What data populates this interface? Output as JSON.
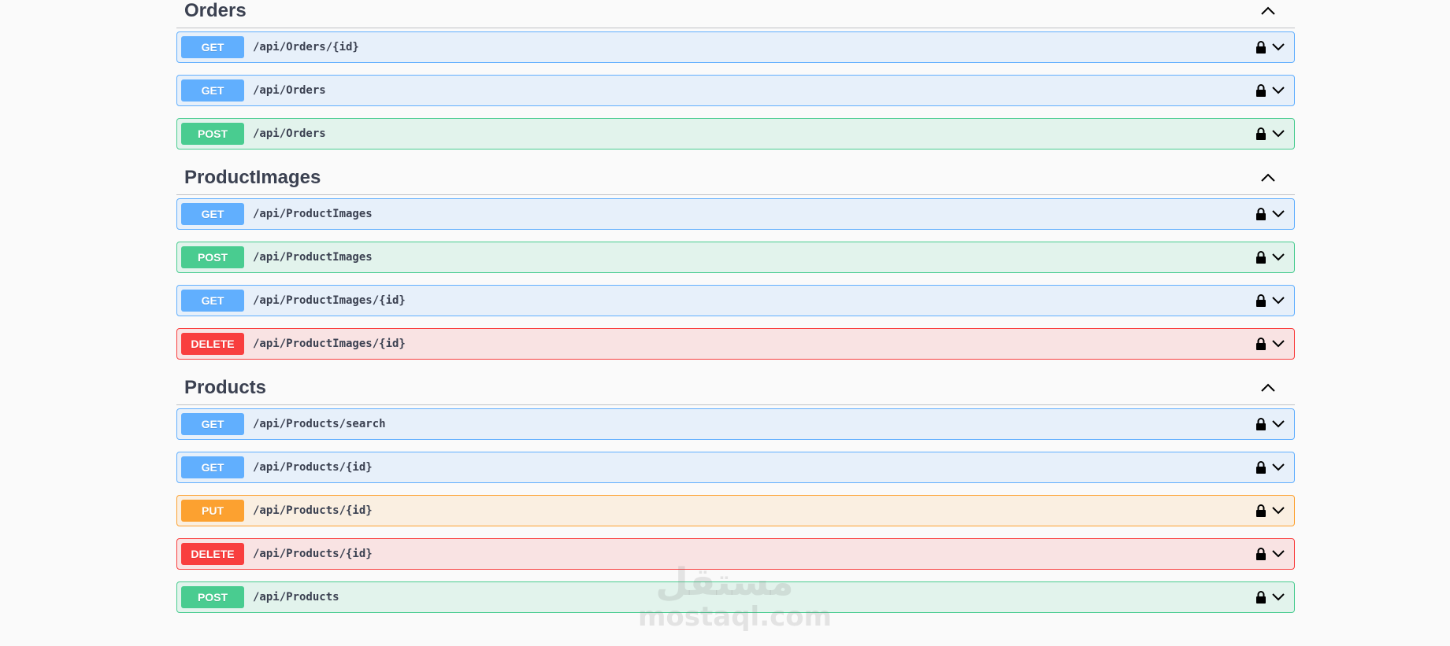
{
  "sections": [
    {
      "name": "Orders",
      "operations": [
        {
          "method": "GET",
          "path": "/api/Orders/{id}"
        },
        {
          "method": "GET",
          "path": "/api/Orders"
        },
        {
          "method": "POST",
          "path": "/api/Orders"
        }
      ]
    },
    {
      "name": "ProductImages",
      "operations": [
        {
          "method": "GET",
          "path": "/api/ProductImages"
        },
        {
          "method": "POST",
          "path": "/api/ProductImages"
        },
        {
          "method": "GET",
          "path": "/api/ProductImages/{id}"
        },
        {
          "method": "DELETE",
          "path": "/api/ProductImages/{id}"
        }
      ]
    },
    {
      "name": "Products",
      "operations": [
        {
          "method": "GET",
          "path": "/api/Products/search"
        },
        {
          "method": "GET",
          "path": "/api/Products/{id}"
        },
        {
          "method": "PUT",
          "path": "/api/Products/{id}"
        },
        {
          "method": "DELETE",
          "path": "/api/Products/{id}"
        },
        {
          "method": "POST",
          "path": "/api/Products"
        }
      ]
    }
  ],
  "watermark": {
    "arabic": "مستقل",
    "latin": "mostaql.com"
  },
  "icons": {
    "section_toggle": "chevron-up-icon",
    "lock": "lock-icon",
    "expand": "chevron-down-icon"
  },
  "colors": {
    "get": "#61affe",
    "post": "#49cc90",
    "put": "#fca130",
    "delete": "#f93e3e",
    "text": "#3b4151"
  }
}
